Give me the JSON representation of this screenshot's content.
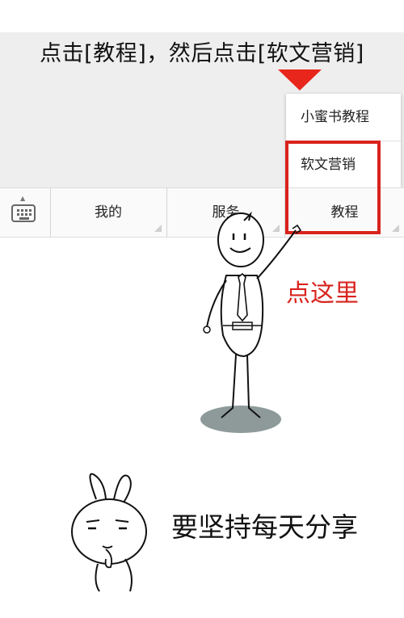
{
  "instruction": "点击[教程]，然后点击[软文营销]",
  "popup": {
    "items": [
      {
        "label": "小蜜书教程"
      },
      {
        "label": "软文营销"
      }
    ]
  },
  "menubar": {
    "tabs": [
      {
        "label": "我的"
      },
      {
        "label": "服务"
      },
      {
        "label": "教程"
      }
    ]
  },
  "callout": "点这里",
  "slogan": "要坚持每天分享",
  "colors": {
    "accent_red": "#d9231d",
    "pointer_red": "#e8261c",
    "gray_background": "#eeeeee",
    "shadow_ellipse": "#8d9a99"
  }
}
